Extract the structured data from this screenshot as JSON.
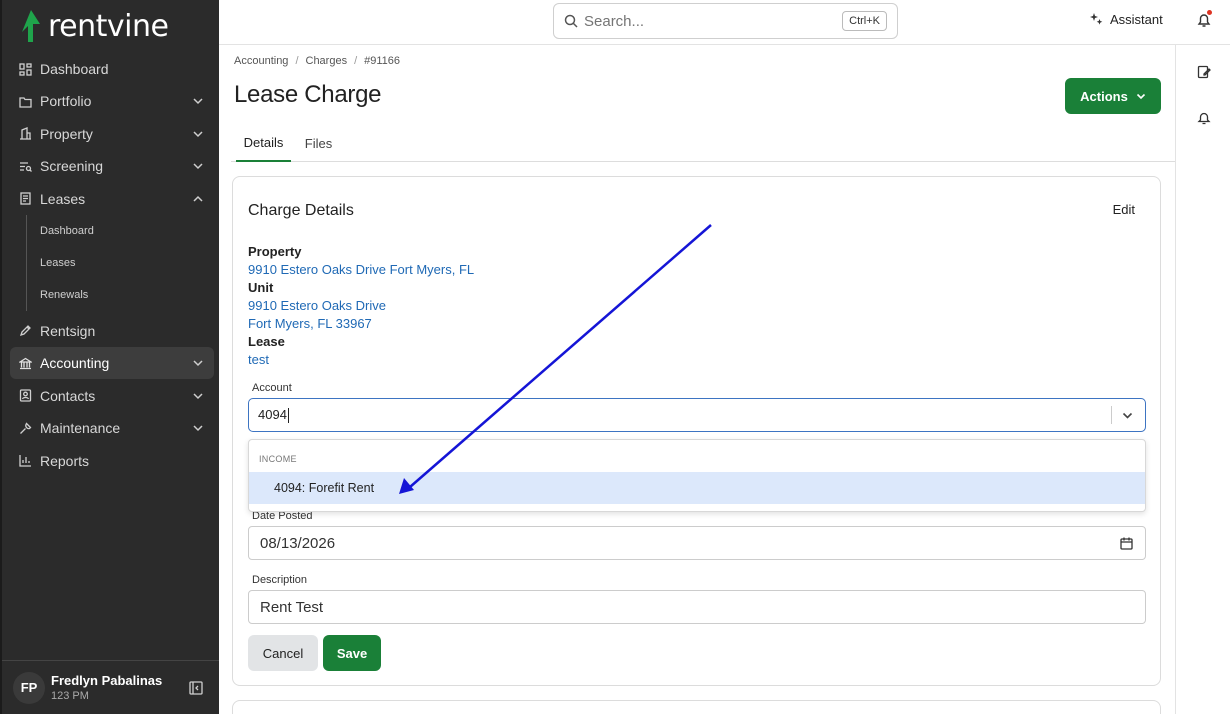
{
  "brand": {
    "name": "rentvine",
    "accent": "#1a8038"
  },
  "sidebar": {
    "items": [
      {
        "label": "Dashboard",
        "icon": "grid-icon"
      },
      {
        "label": "Portfolio",
        "icon": "folder-icon"
      },
      {
        "label": "Property",
        "icon": "building-icon"
      },
      {
        "label": "Screening",
        "icon": "screening-icon"
      },
      {
        "label": "Leases",
        "icon": "document-icon"
      },
      {
        "label": "Rentsign",
        "icon": "pen-icon"
      },
      {
        "label": "Accounting",
        "icon": "bank-icon"
      },
      {
        "label": "Contacts",
        "icon": "contact-icon"
      },
      {
        "label": "Maintenance",
        "icon": "wrench-icon"
      },
      {
        "label": "Reports",
        "icon": "bar-chart-icon"
      }
    ],
    "lease_sub": [
      "Dashboard",
      "Leases",
      "Renewals"
    ],
    "user": {
      "initials": "FP",
      "name": "Fredlyn Pabalinas",
      "sub": "123 PM"
    }
  },
  "topbar": {
    "search_placeholder": "Search...",
    "shortcut": "Ctrl+K",
    "assistant": "Assistant"
  },
  "breadcrumb": [
    "Accounting",
    "Charges",
    "#91166"
  ],
  "page_title": "Lease Charge",
  "actions_label": "Actions",
  "tabs": [
    "Details",
    "Files"
  ],
  "card": {
    "title": "Charge Details",
    "edit": "Edit",
    "property_label": "Property",
    "property_value": "9910 Estero Oaks Drive Fort Myers, FL",
    "unit_label": "Unit",
    "unit_line1": "9910 Estero Oaks Drive",
    "unit_line2": "Fort Myers, FL 33967",
    "lease_label": "Lease",
    "lease_value": "test",
    "account_label": "Account",
    "account_value": "4094",
    "dropdown_group": "INCOME",
    "dropdown_option": "4094: Forefit Rent",
    "date_label": "Date Posted",
    "date_value": "08/13/2026",
    "desc_label": "Description",
    "desc_value": "Rent Test",
    "cancel": "Cancel",
    "save": "Save"
  }
}
